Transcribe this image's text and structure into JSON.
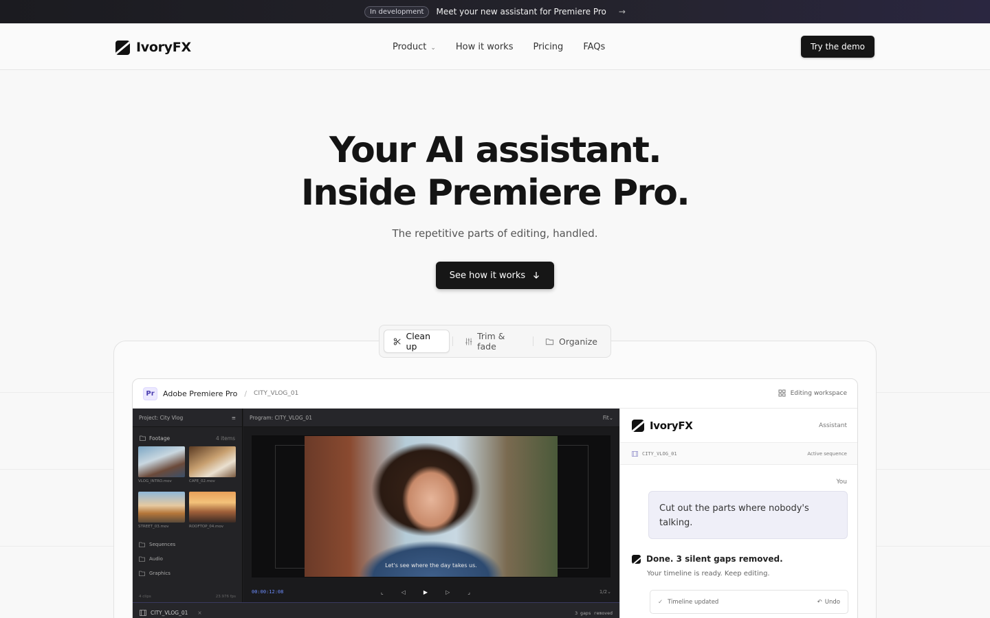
{
  "announce": {
    "badge": "In development",
    "message": "Meet your new assistant for Premiere Pro",
    "arrow": "→"
  },
  "nav": {
    "logo": "IvoryFX",
    "items": [
      {
        "label": "Product",
        "has_dropdown": true
      },
      {
        "label": "How it works"
      },
      {
        "label": "Pricing"
      },
      {
        "label": "FAQs"
      }
    ],
    "cta": "Try the demo"
  },
  "hero": {
    "title_line1": "Your AI assistant.",
    "title_line2": "Inside Premiere Pro.",
    "subtitle": "The repetitive parts of editing, handled.",
    "button": "See how it works"
  },
  "tabs": [
    {
      "label": "Clean up",
      "icon": "scissors-icon",
      "active": true
    },
    {
      "label": "Trim & fade",
      "icon": "sliders-icon",
      "active": false
    },
    {
      "label": "Organize",
      "icon": "folder-icon",
      "active": false
    }
  ],
  "app": {
    "badge": "Pr",
    "name": "Adobe Premiere Pro",
    "crumb": "CITY_VLOG_01",
    "workspace": "Editing workspace",
    "project": {
      "header": "Project: City Vlog",
      "folder": "Footage",
      "folder_count": "4 items",
      "clips": [
        "VLOG_INTRO.mov",
        "CAFE_02.mov",
        "STREET_03.mov",
        "ROOFTOP_04.mov"
      ],
      "bins": [
        "Sequences",
        "Audio",
        "Graphics"
      ],
      "footer_left": "4 clips",
      "footer_right": "23.976 fps"
    },
    "program": {
      "header": "Program: CITY_VLOG_01",
      "fit": "Fit",
      "caption": "Let's see where the day takes us.",
      "timecode": "00:00:12:08",
      "ratio": "1/2"
    },
    "timeline": {
      "sequence": "CITY_VLOG_01",
      "status": "3 gaps removed"
    }
  },
  "assistant": {
    "name": "IvoryFX",
    "tag": "Assistant",
    "sequence": "CITY_VLOG_01",
    "sequence_status": "Active sequence",
    "you_label": "You",
    "user_message": "Cut out the parts where nobody's talking.",
    "done_title": "Done. 3 silent gaps removed.",
    "done_sub": "Your timeline is ready. Keep editing.",
    "updated": "Timeline updated",
    "undo": "Undo"
  }
}
